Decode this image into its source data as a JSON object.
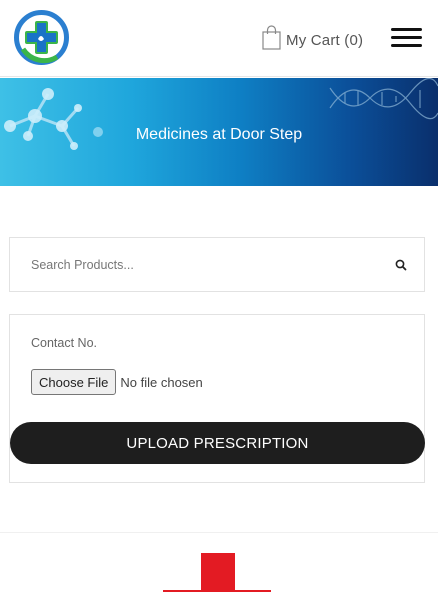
{
  "header": {
    "logo_icon": "pharmacy-cross-logo",
    "cart_label": "My Cart (0)",
    "cart_icon": "shopping-bag-icon",
    "menu_icon": "hamburger-menu-icon"
  },
  "banner": {
    "title": "Medicines at Door Step"
  },
  "search": {
    "placeholder": "Search Products...",
    "icon": "search-icon"
  },
  "upload_form": {
    "contact_label": "Contact No.",
    "choose_file_label": "Choose File",
    "file_status": "No file chosen",
    "submit_label": "UPLOAD PRESCRIPTION"
  },
  "colors": {
    "button_dark": "#1e1e1e",
    "brand_blue": "#1a73c7",
    "brand_green": "#3bb54a",
    "footer_red": "#e31b23"
  }
}
